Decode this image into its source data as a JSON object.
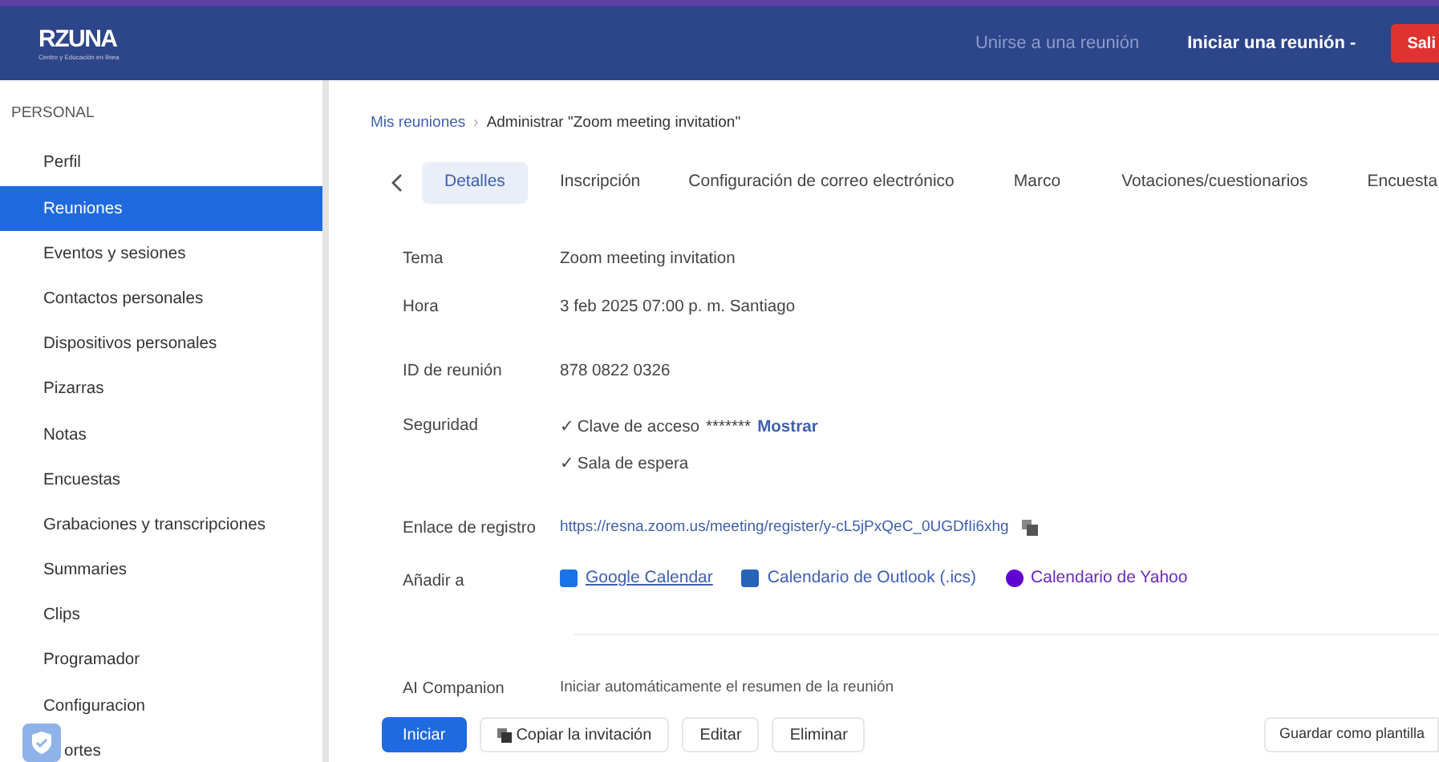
{
  "header": {
    "logo": "RZUNA",
    "logo_tagline": "Centro y Educación en línea",
    "links": [
      "Unirse a una reunión",
      "Iniciar una reunión -"
    ],
    "exit_button": "Sali"
  },
  "sidebar": {
    "section": "PERSONAL",
    "items": [
      {
        "label": "Perfil",
        "selected": false
      },
      {
        "label": "Reuniones",
        "selected": true
      },
      {
        "label": "Eventos y sesiones",
        "selected": false
      },
      {
        "label": "Contactos personales",
        "selected": false
      },
      {
        "label": "Dispositivos personales",
        "selected": false
      },
      {
        "label": "Pizarras",
        "selected": false
      },
      {
        "label": "Notas",
        "selected": false
      },
      {
        "label": "Encuestas",
        "selected": false
      },
      {
        "label": "Grabaciones y transcripciones",
        "selected": false
      },
      {
        "label": "Summaries",
        "selected": false
      },
      {
        "label": "Clips",
        "selected": false
      },
      {
        "label": "Programador",
        "selected": false
      },
      {
        "label": "Configuracion",
        "selected": false
      },
      {
        "label": "ortes",
        "selected": false
      }
    ]
  },
  "breadcrumb": [
    "Mis reuniones",
    "›",
    "Administrar \"Zoom meeting invitation\""
  ],
  "tabs": [
    {
      "label": "Detalles",
      "selected": true
    },
    {
      "label": "Inscripción",
      "selected": false
    },
    {
      "label": "Configuración de correo electrónico",
      "selected": false
    },
    {
      "label": "Marco",
      "selected": false
    },
    {
      "label": "Votaciones/cuestionarios",
      "selected": false
    },
    {
      "label": "Encuesta",
      "selected": false
    }
  ],
  "details": [
    {
      "kind": "text",
      "label": "Tema",
      "value": "Zoom meeting invitation"
    },
    {
      "kind": "text",
      "label": "Hora",
      "value": "3 feb 2025 07:00 p. m. Santiago"
    },
    {
      "kind": "text",
      "label": "ID de reunión",
      "value": "878 0822 0326"
    },
    {
      "kind": "security",
      "label": "Seguridad",
      "passcode_label": "✓ Clave de acceso",
      "passcode": "*******",
      "show_link": "Mostrar",
      "waiting_room": "✓ Sala de espera"
    },
    {
      "kind": "link",
      "label": "Enlace de registro",
      "value": "https://resna.zoom.us/meeting/register/y-cL5jPxQeC_0UGDfIi6xhg"
    },
    {
      "kind": "calendars",
      "label": "Añadir a",
      "calendars": [
        {
          "label": "Google Calendar",
          "color": "#1a73e8"
        },
        {
          "label": "Calendario de Outlook (.ics)",
          "color": "#2564b8"
        },
        {
          "label": "Calendario de Yahoo",
          "color": "#6001d2"
        }
      ]
    }
  ],
  "ai_companion": {
    "label": "AI Companion",
    "value": "Iniciar automáticamente el resumen de la reunión"
  },
  "actions": [
    "Iniciar",
    "Copiar la invitación",
    "Editar",
    "Eliminar"
  ],
  "save_template": "Guardar como plantilla"
}
